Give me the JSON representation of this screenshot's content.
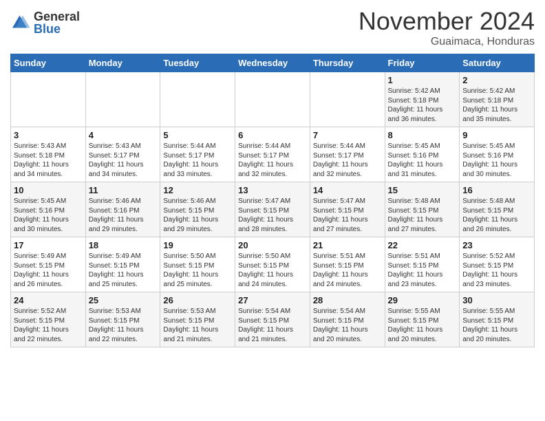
{
  "logo": {
    "general": "General",
    "blue": "Blue"
  },
  "header": {
    "month": "November 2024",
    "location": "Guaimaca, Honduras"
  },
  "weekdays": [
    "Sunday",
    "Monday",
    "Tuesday",
    "Wednesday",
    "Thursday",
    "Friday",
    "Saturday"
  ],
  "weeks": [
    [
      {
        "day": "",
        "info": ""
      },
      {
        "day": "",
        "info": ""
      },
      {
        "day": "",
        "info": ""
      },
      {
        "day": "",
        "info": ""
      },
      {
        "day": "",
        "info": ""
      },
      {
        "day": "1",
        "info": "Sunrise: 5:42 AM\nSunset: 5:18 PM\nDaylight: 11 hours\nand 36 minutes."
      },
      {
        "day": "2",
        "info": "Sunrise: 5:42 AM\nSunset: 5:18 PM\nDaylight: 11 hours\nand 35 minutes."
      }
    ],
    [
      {
        "day": "3",
        "info": "Sunrise: 5:43 AM\nSunset: 5:18 PM\nDaylight: 11 hours\nand 34 minutes."
      },
      {
        "day": "4",
        "info": "Sunrise: 5:43 AM\nSunset: 5:17 PM\nDaylight: 11 hours\nand 34 minutes."
      },
      {
        "day": "5",
        "info": "Sunrise: 5:44 AM\nSunset: 5:17 PM\nDaylight: 11 hours\nand 33 minutes."
      },
      {
        "day": "6",
        "info": "Sunrise: 5:44 AM\nSunset: 5:17 PM\nDaylight: 11 hours\nand 32 minutes."
      },
      {
        "day": "7",
        "info": "Sunrise: 5:44 AM\nSunset: 5:17 PM\nDaylight: 11 hours\nand 32 minutes."
      },
      {
        "day": "8",
        "info": "Sunrise: 5:45 AM\nSunset: 5:16 PM\nDaylight: 11 hours\nand 31 minutes."
      },
      {
        "day": "9",
        "info": "Sunrise: 5:45 AM\nSunset: 5:16 PM\nDaylight: 11 hours\nand 30 minutes."
      }
    ],
    [
      {
        "day": "10",
        "info": "Sunrise: 5:45 AM\nSunset: 5:16 PM\nDaylight: 11 hours\nand 30 minutes."
      },
      {
        "day": "11",
        "info": "Sunrise: 5:46 AM\nSunset: 5:16 PM\nDaylight: 11 hours\nand 29 minutes."
      },
      {
        "day": "12",
        "info": "Sunrise: 5:46 AM\nSunset: 5:15 PM\nDaylight: 11 hours\nand 29 minutes."
      },
      {
        "day": "13",
        "info": "Sunrise: 5:47 AM\nSunset: 5:15 PM\nDaylight: 11 hours\nand 28 minutes."
      },
      {
        "day": "14",
        "info": "Sunrise: 5:47 AM\nSunset: 5:15 PM\nDaylight: 11 hours\nand 27 minutes."
      },
      {
        "day": "15",
        "info": "Sunrise: 5:48 AM\nSunset: 5:15 PM\nDaylight: 11 hours\nand 27 minutes."
      },
      {
        "day": "16",
        "info": "Sunrise: 5:48 AM\nSunset: 5:15 PM\nDaylight: 11 hours\nand 26 minutes."
      }
    ],
    [
      {
        "day": "17",
        "info": "Sunrise: 5:49 AM\nSunset: 5:15 PM\nDaylight: 11 hours\nand 26 minutes."
      },
      {
        "day": "18",
        "info": "Sunrise: 5:49 AM\nSunset: 5:15 PM\nDaylight: 11 hours\nand 25 minutes."
      },
      {
        "day": "19",
        "info": "Sunrise: 5:50 AM\nSunset: 5:15 PM\nDaylight: 11 hours\nand 25 minutes."
      },
      {
        "day": "20",
        "info": "Sunrise: 5:50 AM\nSunset: 5:15 PM\nDaylight: 11 hours\nand 24 minutes."
      },
      {
        "day": "21",
        "info": "Sunrise: 5:51 AM\nSunset: 5:15 PM\nDaylight: 11 hours\nand 24 minutes."
      },
      {
        "day": "22",
        "info": "Sunrise: 5:51 AM\nSunset: 5:15 PM\nDaylight: 11 hours\nand 23 minutes."
      },
      {
        "day": "23",
        "info": "Sunrise: 5:52 AM\nSunset: 5:15 PM\nDaylight: 11 hours\nand 23 minutes."
      }
    ],
    [
      {
        "day": "24",
        "info": "Sunrise: 5:52 AM\nSunset: 5:15 PM\nDaylight: 11 hours\nand 22 minutes."
      },
      {
        "day": "25",
        "info": "Sunrise: 5:53 AM\nSunset: 5:15 PM\nDaylight: 11 hours\nand 22 minutes."
      },
      {
        "day": "26",
        "info": "Sunrise: 5:53 AM\nSunset: 5:15 PM\nDaylight: 11 hours\nand 21 minutes."
      },
      {
        "day": "27",
        "info": "Sunrise: 5:54 AM\nSunset: 5:15 PM\nDaylight: 11 hours\nand 21 minutes."
      },
      {
        "day": "28",
        "info": "Sunrise: 5:54 AM\nSunset: 5:15 PM\nDaylight: 11 hours\nand 20 minutes."
      },
      {
        "day": "29",
        "info": "Sunrise: 5:55 AM\nSunset: 5:15 PM\nDaylight: 11 hours\nand 20 minutes."
      },
      {
        "day": "30",
        "info": "Sunrise: 5:55 AM\nSunset: 5:15 PM\nDaylight: 11 hours\nand 20 minutes."
      }
    ]
  ]
}
